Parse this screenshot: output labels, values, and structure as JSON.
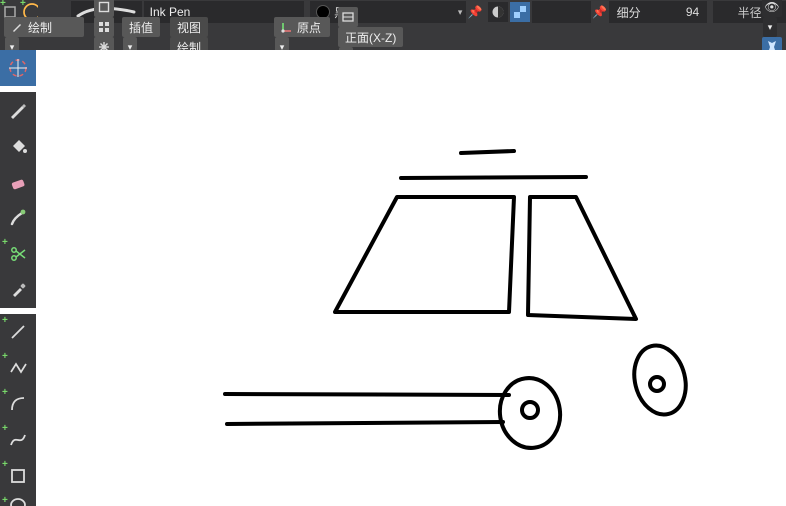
{
  "topbar": {
    "brush_name": "Ink Pen",
    "color_name": "黑",
    "strength_label": "细分",
    "strength_value": "94",
    "radius_label": "半径"
  },
  "secbar": {
    "mode_label": "绘制",
    "interp_label": "插值",
    "view_label": "视图",
    "draw_label": "绘制",
    "origin_label": "原点",
    "plane_label": "正面(X-Z)"
  },
  "icons": {
    "pin": "📌",
    "globe": "◐",
    "layers": "🗂",
    "eye": "👁",
    "butterfly": "✦"
  }
}
